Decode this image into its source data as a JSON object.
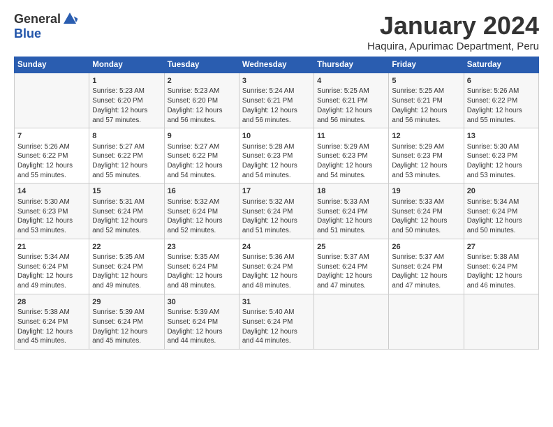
{
  "logo": {
    "general": "General",
    "blue": "Blue"
  },
  "title": "January 2024",
  "subtitle": "Haquira, Apurimac Department, Peru",
  "weekdays": [
    "Sunday",
    "Monday",
    "Tuesday",
    "Wednesday",
    "Thursday",
    "Friday",
    "Saturday"
  ],
  "weeks": [
    [
      {
        "day": "",
        "info": ""
      },
      {
        "day": "1",
        "info": "Sunrise: 5:23 AM\nSunset: 6:20 PM\nDaylight: 12 hours\nand 57 minutes."
      },
      {
        "day": "2",
        "info": "Sunrise: 5:23 AM\nSunset: 6:20 PM\nDaylight: 12 hours\nand 56 minutes."
      },
      {
        "day": "3",
        "info": "Sunrise: 5:24 AM\nSunset: 6:21 PM\nDaylight: 12 hours\nand 56 minutes."
      },
      {
        "day": "4",
        "info": "Sunrise: 5:25 AM\nSunset: 6:21 PM\nDaylight: 12 hours\nand 56 minutes."
      },
      {
        "day": "5",
        "info": "Sunrise: 5:25 AM\nSunset: 6:21 PM\nDaylight: 12 hours\nand 56 minutes."
      },
      {
        "day": "6",
        "info": "Sunrise: 5:26 AM\nSunset: 6:22 PM\nDaylight: 12 hours\nand 55 minutes."
      }
    ],
    [
      {
        "day": "7",
        "info": "Sunrise: 5:26 AM\nSunset: 6:22 PM\nDaylight: 12 hours\nand 55 minutes."
      },
      {
        "day": "8",
        "info": "Sunrise: 5:27 AM\nSunset: 6:22 PM\nDaylight: 12 hours\nand 55 minutes."
      },
      {
        "day": "9",
        "info": "Sunrise: 5:27 AM\nSunset: 6:22 PM\nDaylight: 12 hours\nand 54 minutes."
      },
      {
        "day": "10",
        "info": "Sunrise: 5:28 AM\nSunset: 6:23 PM\nDaylight: 12 hours\nand 54 minutes."
      },
      {
        "day": "11",
        "info": "Sunrise: 5:29 AM\nSunset: 6:23 PM\nDaylight: 12 hours\nand 54 minutes."
      },
      {
        "day": "12",
        "info": "Sunrise: 5:29 AM\nSunset: 6:23 PM\nDaylight: 12 hours\nand 53 minutes."
      },
      {
        "day": "13",
        "info": "Sunrise: 5:30 AM\nSunset: 6:23 PM\nDaylight: 12 hours\nand 53 minutes."
      }
    ],
    [
      {
        "day": "14",
        "info": "Sunrise: 5:30 AM\nSunset: 6:23 PM\nDaylight: 12 hours\nand 53 minutes."
      },
      {
        "day": "15",
        "info": "Sunrise: 5:31 AM\nSunset: 6:24 PM\nDaylight: 12 hours\nand 52 minutes."
      },
      {
        "day": "16",
        "info": "Sunrise: 5:32 AM\nSunset: 6:24 PM\nDaylight: 12 hours\nand 52 minutes."
      },
      {
        "day": "17",
        "info": "Sunrise: 5:32 AM\nSunset: 6:24 PM\nDaylight: 12 hours\nand 51 minutes."
      },
      {
        "day": "18",
        "info": "Sunrise: 5:33 AM\nSunset: 6:24 PM\nDaylight: 12 hours\nand 51 minutes."
      },
      {
        "day": "19",
        "info": "Sunrise: 5:33 AM\nSunset: 6:24 PM\nDaylight: 12 hours\nand 50 minutes."
      },
      {
        "day": "20",
        "info": "Sunrise: 5:34 AM\nSunset: 6:24 PM\nDaylight: 12 hours\nand 50 minutes."
      }
    ],
    [
      {
        "day": "21",
        "info": "Sunrise: 5:34 AM\nSunset: 6:24 PM\nDaylight: 12 hours\nand 49 minutes."
      },
      {
        "day": "22",
        "info": "Sunrise: 5:35 AM\nSunset: 6:24 PM\nDaylight: 12 hours\nand 49 minutes."
      },
      {
        "day": "23",
        "info": "Sunrise: 5:35 AM\nSunset: 6:24 PM\nDaylight: 12 hours\nand 48 minutes."
      },
      {
        "day": "24",
        "info": "Sunrise: 5:36 AM\nSunset: 6:24 PM\nDaylight: 12 hours\nand 48 minutes."
      },
      {
        "day": "25",
        "info": "Sunrise: 5:37 AM\nSunset: 6:24 PM\nDaylight: 12 hours\nand 47 minutes."
      },
      {
        "day": "26",
        "info": "Sunrise: 5:37 AM\nSunset: 6:24 PM\nDaylight: 12 hours\nand 47 minutes."
      },
      {
        "day": "27",
        "info": "Sunrise: 5:38 AM\nSunset: 6:24 PM\nDaylight: 12 hours\nand 46 minutes."
      }
    ],
    [
      {
        "day": "28",
        "info": "Sunrise: 5:38 AM\nSunset: 6:24 PM\nDaylight: 12 hours\nand 45 minutes."
      },
      {
        "day": "29",
        "info": "Sunrise: 5:39 AM\nSunset: 6:24 PM\nDaylight: 12 hours\nand 45 minutes."
      },
      {
        "day": "30",
        "info": "Sunrise: 5:39 AM\nSunset: 6:24 PM\nDaylight: 12 hours\nand 44 minutes."
      },
      {
        "day": "31",
        "info": "Sunrise: 5:40 AM\nSunset: 6:24 PM\nDaylight: 12 hours\nand 44 minutes."
      },
      {
        "day": "",
        "info": ""
      },
      {
        "day": "",
        "info": ""
      },
      {
        "day": "",
        "info": ""
      }
    ]
  ]
}
